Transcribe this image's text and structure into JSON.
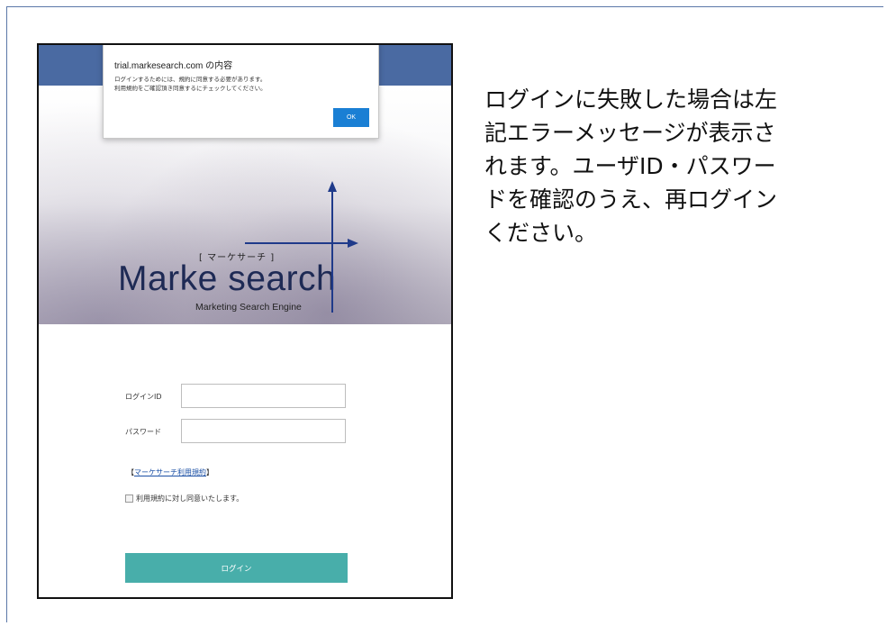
{
  "dialog": {
    "title": "trial.markesearch.com の内容",
    "message_line1": "ログインするためには、規約に同意する必要があります。",
    "message_line2": "利用規約をご確認頂き同意するにチェックしてください。",
    "ok_label": "OK"
  },
  "logo": {
    "subtitle": "[ マーケサーチ ]",
    "main": "Marke search",
    "tagline": "Marketing Search Engine"
  },
  "form": {
    "login_id_label": "ログインID",
    "login_id_value": "",
    "password_label": "パスワード",
    "password_value": "",
    "terms_bracket_open": "【",
    "terms_link": "マーケサーチ利用規約",
    "terms_bracket_close": "】",
    "agree_label": "利用規約に対し同意いたします。",
    "agree_checked": false,
    "login_button": "ログイン"
  },
  "note": {
    "line1": "ログインに失敗した場合は左",
    "line2": "記エラーメッセージが表示さ",
    "line3": "れます。ユーザID・パスワー",
    "line4": "ドを確認のうえ、再ログイン",
    "line5": "ください。"
  },
  "colors": {
    "topbar": "#4a6aa2",
    "ok_button": "#1a7fd4",
    "login_button": "#48aeaa",
    "logo_text": "#1e2a55"
  }
}
